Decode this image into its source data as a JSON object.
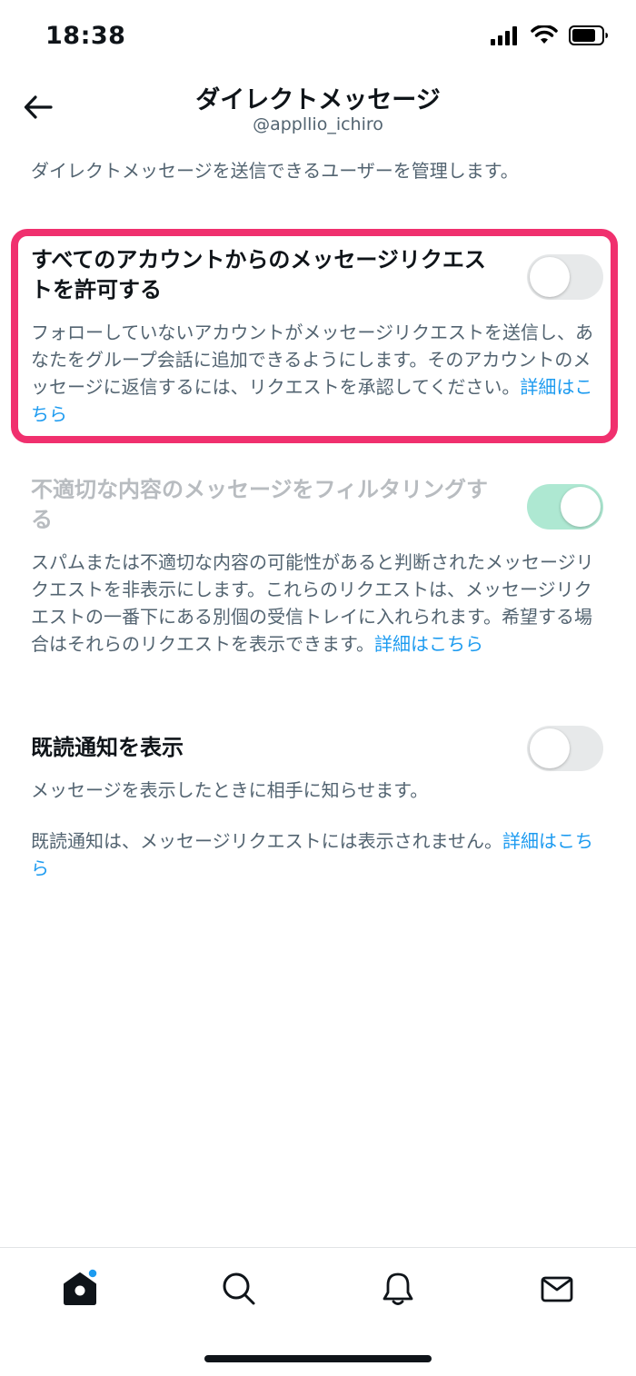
{
  "status_bar": {
    "time": "18:38"
  },
  "header": {
    "title": "ダイレクトメッセージ",
    "subtitle": "@appllio_ichiro"
  },
  "description": "ダイレクトメッセージを送信できるユーザーを管理します。",
  "settings": [
    {
      "title": "すべてのアカウントからのメッセージリクエストを許可する",
      "description": "フォローしていないアカウントがメッセージリクエストを送信し、あなたをグループ会話に追加できるようにします。そのアカウントのメッセージに返信するには、リクエストを承認してください。",
      "link": "詳細はこちら",
      "toggle": "off",
      "highlighted": true
    },
    {
      "title": "不適切な内容のメッセージをフィルタリングする",
      "description": "スパムまたは不適切な内容の可能性があると判断されたメッセージリクエストを非表示にします。これらのリクエストは、メッセージリクエストの一番下にある別個の受信トレイに入れられます。希望する場合はそれらのリクエストを表示できます。",
      "link": "詳細はこちら",
      "toggle": "on",
      "disabled": true
    },
    {
      "title": "既読通知を表示",
      "description": "メッセージを表示したときに相手に知らせます。",
      "note": "既読通知は、メッセージリクエストには表示されません。",
      "link": "詳細はこちら",
      "toggle": "off"
    }
  ],
  "tab_bar": {
    "items": [
      {
        "icon": "home-icon",
        "active": true,
        "has_notification_dot": true
      },
      {
        "icon": "search-icon"
      },
      {
        "icon": "bell-icon"
      },
      {
        "icon": "mail-icon"
      }
    ]
  },
  "colors": {
    "accent": "#1d9bf0",
    "highlight_border": "#f0306e",
    "toggle_on": "#aee8d2",
    "toggle_off": "#e7e9ea"
  }
}
